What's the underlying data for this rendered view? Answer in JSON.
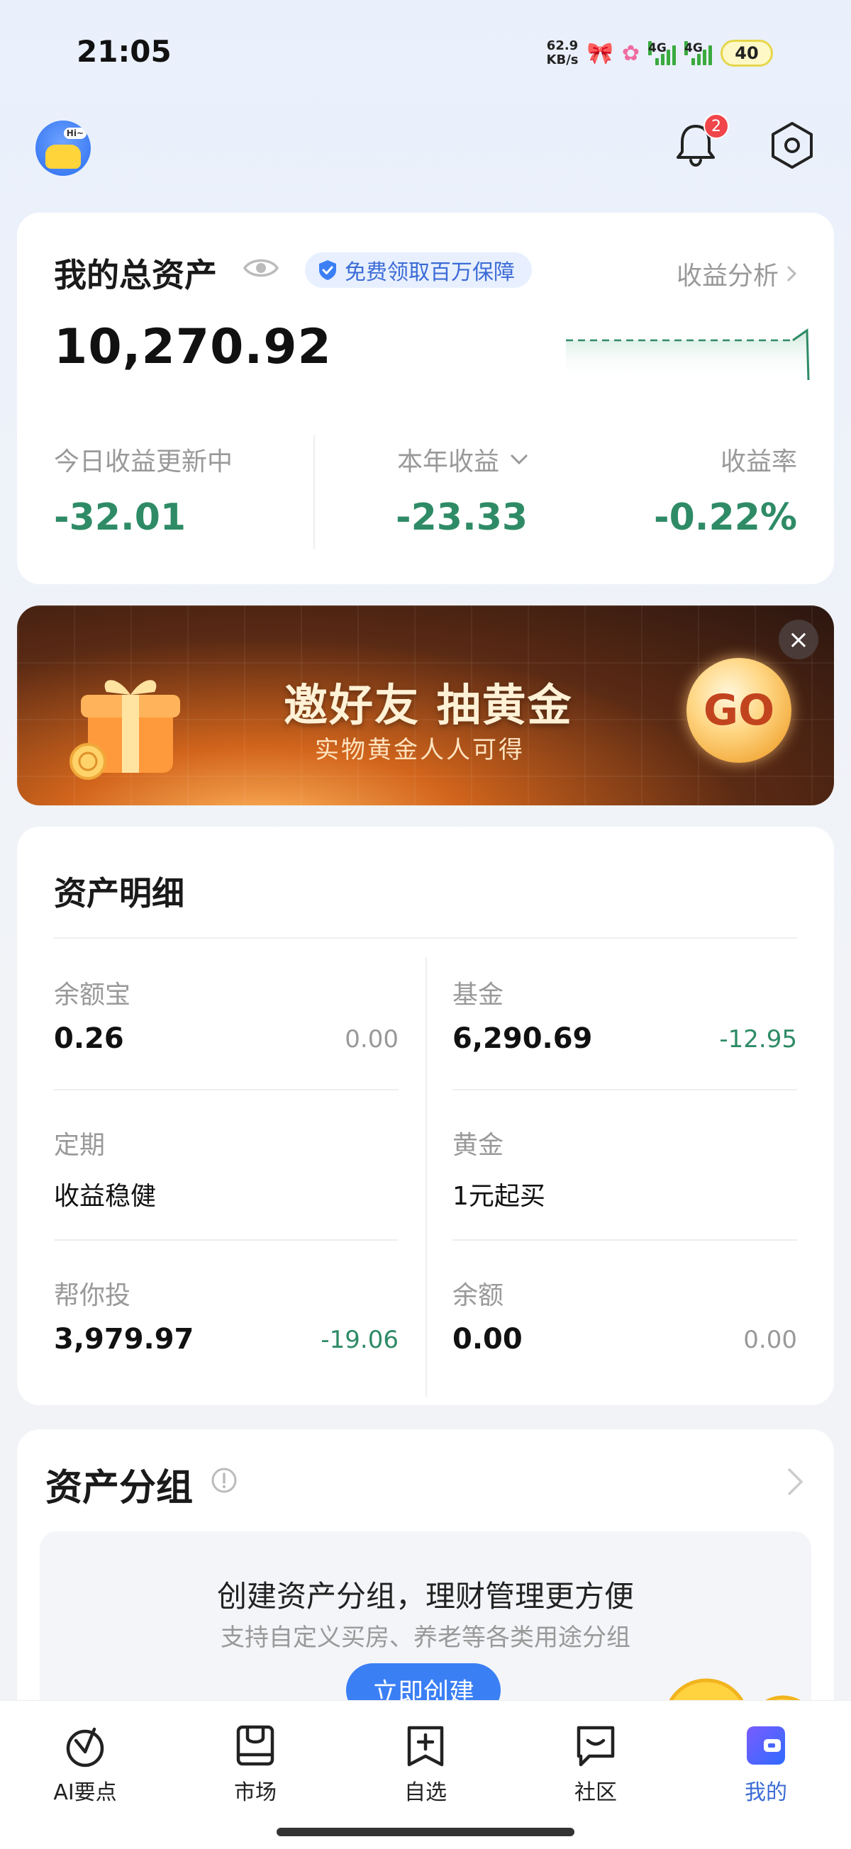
{
  "status_bar": {
    "time": "21:05",
    "net_speed_value": "62.9",
    "net_speed_unit": "KB/s",
    "signal1_label": "4G",
    "signal2_label": "4G",
    "battery": "40"
  },
  "header": {
    "avatar_bubble": "Hi~",
    "notification_count": "2"
  },
  "assets": {
    "title": "我的总资产",
    "promo": "免费领取百万保障",
    "analysis_link": "收益分析",
    "total": "10,270.92",
    "stats": [
      {
        "label": "今日收益更新中",
        "value": "-32.01"
      },
      {
        "label": "本年收益",
        "value": "-23.33"
      },
      {
        "label": "收益率",
        "value": "-0.22%"
      }
    ]
  },
  "banner": {
    "title": "邀好友 抽黄金",
    "subtitle": "实物黄金人人可得",
    "cta": "GO",
    "close": "×"
  },
  "details": {
    "title": "资产明细",
    "items": [
      {
        "label": "余额宝",
        "value": "0.26",
        "change": "0.00"
      },
      {
        "label": "基金",
        "value": "6,290.69",
        "change": "-12.95"
      },
      {
        "label": "定期",
        "value": "收益稳健",
        "change": ""
      },
      {
        "label": "黄金",
        "value": "1元起买",
        "change": ""
      },
      {
        "label": "帮你投",
        "value": "3,979.97",
        "change": "-19.06"
      },
      {
        "label": "余额",
        "value": "0.00",
        "change": "0.00"
      }
    ]
  },
  "groups": {
    "title": "资产分组",
    "inner_title": "创建资产分组，理财管理更方便",
    "inner_subtitle": "支持自定义买房、养老等各类用途分组",
    "create_button": "立即创建"
  },
  "tabbar": {
    "tabs": [
      {
        "label": "AI要点",
        "icon": "ai-icon"
      },
      {
        "label": "市场",
        "icon": "market-icon"
      },
      {
        "label": "自选",
        "icon": "watchlist-icon"
      },
      {
        "label": "社区",
        "icon": "community-icon"
      },
      {
        "label": "我的",
        "icon": "wallet-icon"
      }
    ],
    "active_index": 4
  },
  "colors": {
    "accent": "#3b6bd6",
    "negative": "#2e8b66",
    "muted": "#999999"
  }
}
